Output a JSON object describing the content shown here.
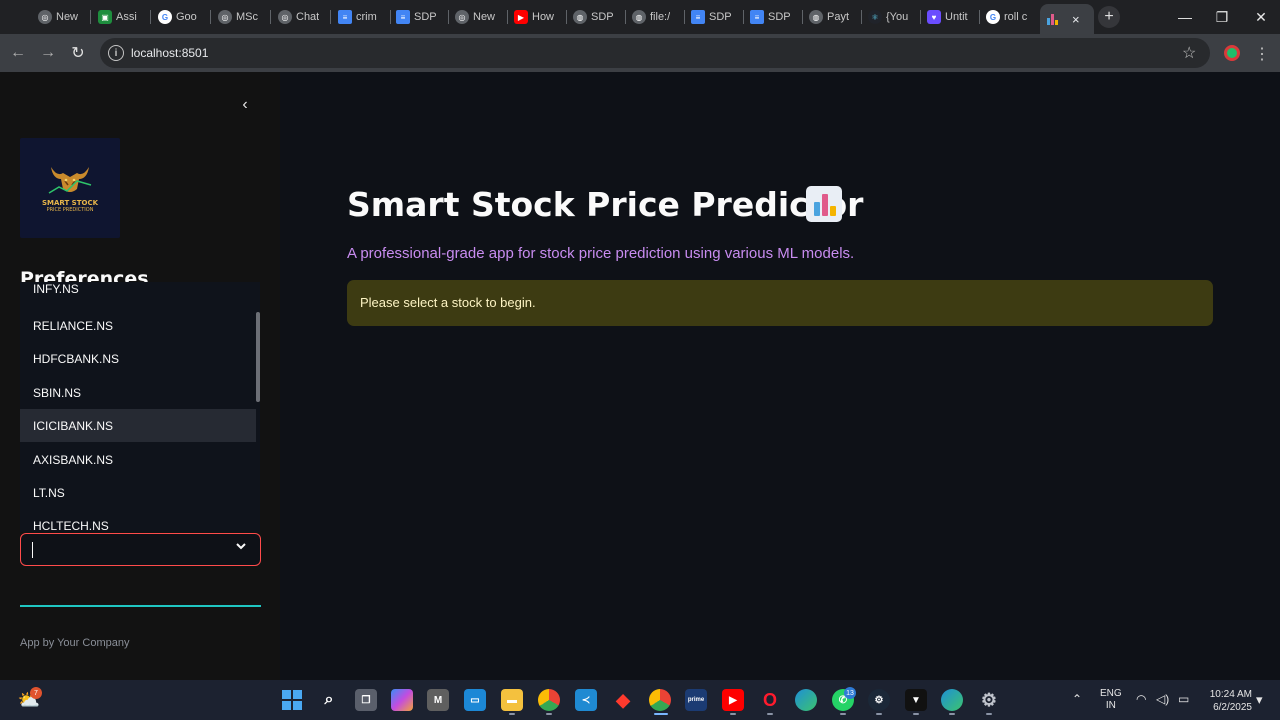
{
  "browser": {
    "tabs": [
      {
        "label": "New",
        "icon": "chatgpt-icon",
        "color": "#5f6368"
      },
      {
        "label": "Assi",
        "icon": "classroom-icon",
        "color": "#1e8e3e"
      },
      {
        "label": "Goo",
        "icon": "google-icon",
        "color": "#ffffff"
      },
      {
        "label": "MSc",
        "icon": "chatgpt-icon",
        "color": "#5f6368"
      },
      {
        "label": "Chat",
        "icon": "chatgpt-icon",
        "color": "#5f6368"
      },
      {
        "label": "crim",
        "icon": "docs-icon",
        "color": "#4285f4"
      },
      {
        "label": "SDP",
        "icon": "docs-icon",
        "color": "#4285f4"
      },
      {
        "label": "New",
        "icon": "chatgpt-icon",
        "color": "#5f6368"
      },
      {
        "label": "How",
        "icon": "youtube-icon",
        "color": "#ff0000"
      },
      {
        "label": "SDP",
        "icon": "globe-icon",
        "color": "#5f6368"
      },
      {
        "label": "file:/",
        "icon": "globe-icon",
        "color": "#5f6368"
      },
      {
        "label": "SDP",
        "icon": "docs-icon",
        "color": "#4285f4"
      },
      {
        "label": "SDP",
        "icon": "docs-icon",
        "color": "#4285f4"
      },
      {
        "label": "Payt",
        "icon": "globe-icon",
        "color": "#5f6368"
      },
      {
        "label": "{You",
        "icon": "react-icon",
        "color": "#61dafb"
      },
      {
        "label": "Untit",
        "icon": "heart-icon",
        "color": "#6b4dff"
      },
      {
        "label": "roll c",
        "icon": "google-icon",
        "color": "#ffffff"
      }
    ],
    "active_tab_icon": "bar-chart-icon",
    "active_tab_close": "×",
    "new_tab": "+",
    "url": "localhost:8501",
    "window_controls": {
      "minimize": "—",
      "maximize": "❐",
      "close": "✕"
    }
  },
  "sidebar": {
    "collapse_glyph": "‹",
    "logo": {
      "title": "SMART STOCK",
      "subtitle": "PRICE PREDICTION"
    },
    "heading": "Preferences",
    "dropdown": {
      "options": [
        "INFY.NS",
        "RELIANCE.NS",
        "HDFCBANK.NS",
        "SBIN.NS",
        "ICICIBANK.NS",
        "AXISBANK.NS",
        "LT.NS",
        "HCLTECH.NS"
      ],
      "highlighted": "ICICIBANK.NS"
    },
    "select": {
      "value": "",
      "chevron": "⌄"
    },
    "footer": "App by Your Company"
  },
  "main": {
    "title": "Smart Stock Price Predictor",
    "subtitle": "A professional-grade app for stock price prediction using various ML models.",
    "alert": "Please select a stock to begin.",
    "colors": {
      "subtitle": "#c88cf0",
      "alert_bg": "#3d3b12",
      "select_border": "#ff4b4b",
      "divider": "#1fc7c2"
    }
  },
  "taskbar": {
    "weather_badge": "7",
    "whatsapp_badge": "13",
    "lang": {
      "line1": "ENG",
      "line2": "IN"
    },
    "time": "10:24 AM",
    "date": "6/2/2025",
    "apps": [
      "start-icon",
      "search-icon",
      "task-view-icon",
      "copilot-icon",
      "app-icon",
      "desktop-icon",
      "file-explorer-icon",
      "chrome-icon",
      "vscode-icon",
      "git-icon",
      "chrome-icon",
      "prime-video-icon",
      "youtube-icon",
      "opera-icon",
      "edge-icon",
      "whatsapp-icon",
      "steam-icon",
      "app-icon",
      "chrome-canary-icon",
      "settings-icon"
    ]
  }
}
